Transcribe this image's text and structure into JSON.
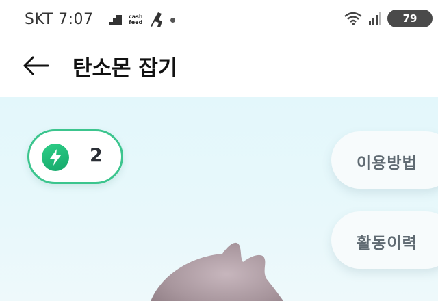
{
  "status_bar": {
    "carrier": "SKT",
    "time": "7:07",
    "cashfeed_line1": "cash",
    "cashfeed_line2": "feed",
    "battery": "79"
  },
  "header": {
    "title": "탄소몬 잡기"
  },
  "energy": {
    "count": "2"
  },
  "side_buttons": {
    "howto": "이용방법",
    "history": "활동이력"
  },
  "colors": {
    "accent_green": "#1fbf7d",
    "main_bg": "#e3f7fb"
  },
  "icons": [
    "back-arrow-icon",
    "lightning-icon",
    "wifi-icon",
    "signal-icon",
    "battery-icon",
    "cashfeed-icon",
    "running-icon"
  ]
}
